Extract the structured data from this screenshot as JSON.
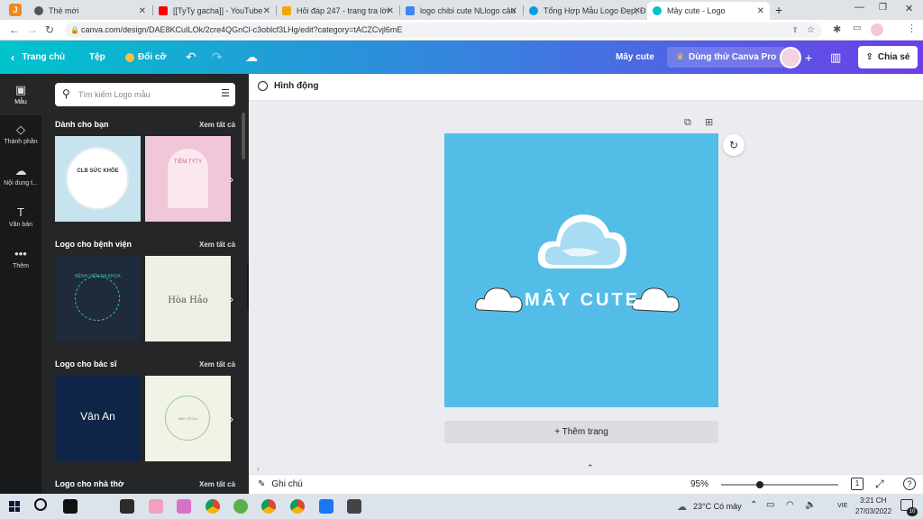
{
  "browser": {
    "tabs": [
      {
        "title": "Thẻ mới",
        "color": "#555555"
      },
      {
        "title": "[[TyTy gacha]] - YouTube",
        "color": "#ff0000"
      },
      {
        "title": "Hỏi đáp 247 - trang tra lời",
        "color": "#f0a800"
      },
      {
        "title": "logo chibi cute NLlogo câu",
        "color": "#4285f4"
      },
      {
        "title": "Tổng Hợp Mẫu Logo Đẹp, Đ",
        "color": "#00a0e0"
      },
      {
        "title": "Mây cute - Logo",
        "color": "#00c4cc"
      }
    ],
    "url": "canva.com/design/DAE8KCuILOk/2cre4QGnCl-c3oblcf3LHg/edit?category=tACZCvjl6mE"
  },
  "header": {
    "home": "Trang chủ",
    "file": "Tệp",
    "resize": "Đổi cỡ",
    "design_title": "Mây cute",
    "pro": "Dùng thử Canva Pro",
    "share": "Chia sẻ"
  },
  "rail": [
    {
      "label": "Mẫu",
      "icon": "▣"
    },
    {
      "label": "Thành phần",
      "icon": "◇"
    },
    {
      "label": "Nội dung t...",
      "icon": "☁"
    },
    {
      "label": "Văn bản",
      "icon": "T"
    },
    {
      "label": "Thêm",
      "icon": "•••"
    }
  ],
  "panel": {
    "search_placeholder": "Tìm kiếm Logo mẫu",
    "see_all": "Xem tất cả",
    "sections": [
      {
        "title": "Dành cho bạn",
        "thumbs": [
          {
            "text": "CLB SỨC KHỎE",
            "bg": "#c7e3ee"
          },
          {
            "text": "TIỆM TYTY",
            "bg": "#f1c6d8"
          }
        ]
      },
      {
        "title": "Logo cho bệnh viện",
        "thumbs": [
          {
            "text": "BỆNH VIỆN ĐA KHOA",
            "bg": "#1f2b3a"
          },
          {
            "text": "Hòa Hảo",
            "bg": "#eef0e6"
          }
        ]
      },
      {
        "title": "Logo cho bác sĩ",
        "thumbs": [
          {
            "text": "Vân An",
            "bg": "#0f2547"
          },
          {
            "text": "BÁC SĨ GIA",
            "bg": "#f1f3e7"
          }
        ]
      },
      {
        "title": "Logo cho nhà thờ",
        "thumbs": []
      }
    ]
  },
  "toolbar": {
    "animate": "Hình động"
  },
  "design": {
    "text": "MÂY CUTE",
    "bg": "#53bde8"
  },
  "add_page": "+ Thêm trang",
  "footer": {
    "notes": "Ghi chú",
    "zoom": "95%",
    "page_count": "1",
    "zoom_level": 0.3
  },
  "taskbar": {
    "weather": "23°C  Có mây",
    "lang": "VIE",
    "time": "3:21 CH",
    "date": "27/03/2022",
    "notif_count": "10"
  }
}
